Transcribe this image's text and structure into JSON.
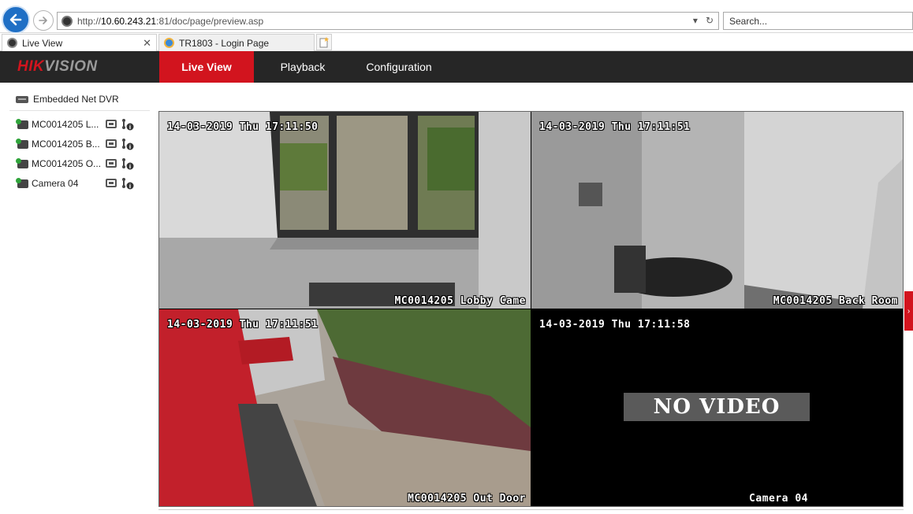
{
  "browser": {
    "url_prefix": "http://",
    "url_host": "10.60.243.21",
    "url_rest": ":81/doc/page/preview.asp",
    "search_placeholder": "Search...",
    "tabs": [
      {
        "label": "Live View",
        "active": true
      },
      {
        "label": "TR1803 - Login Page",
        "active": false
      }
    ]
  },
  "app": {
    "logo_red": "HIK",
    "logo_grey": "VISION",
    "menu": [
      {
        "label": "Live View",
        "active": true
      },
      {
        "label": "Playback",
        "active": false
      },
      {
        "label": "Configuration",
        "active": false
      }
    ],
    "brand_color": "#d2141e"
  },
  "sidebar": {
    "device": "Embedded Net DVR",
    "cameras": [
      {
        "label": "MC0014205 L..."
      },
      {
        "label": "MC0014205 B..."
      },
      {
        "label": "MC0014205 O..."
      },
      {
        "label": "Camera 04"
      }
    ]
  },
  "views": [
    {
      "timestamp": "14-03-2019 Thu 17:11:50",
      "name": "MC0014205 Lobby Came",
      "selected": true,
      "no_video": false
    },
    {
      "timestamp": "14-03-2019 Thu 17:11:51",
      "name": "MC0014205 Back Room",
      "selected": false,
      "no_video": false
    },
    {
      "timestamp": "14-03-2019 Thu 17:11:51",
      "name": "MC0014205 Out Door",
      "selected": false,
      "no_video": false
    },
    {
      "timestamp": "14-03-2019 Thu 17:11:58",
      "name": "Camera 04",
      "selected": false,
      "no_video": true,
      "no_video_text": "NO VIDEO"
    }
  ]
}
